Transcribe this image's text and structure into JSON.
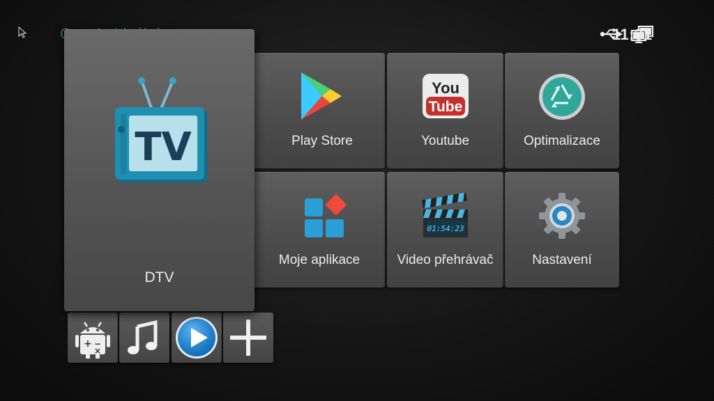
{
  "header": {
    "title": "Google Ideální",
    "clock": "11:31",
    "icons": [
      "usb-icon",
      "network-icon"
    ]
  },
  "tiles": {
    "dtv": {
      "label": "DTV",
      "icon": "tv-icon"
    },
    "play_store": {
      "label": "Play Store",
      "icon": "play-store-icon"
    },
    "youtube": {
      "label": "Youtube",
      "icon": "youtube-icon",
      "logo_top": "You",
      "logo_bottom": "Tube"
    },
    "optimalizace": {
      "label": "Optimalizace",
      "icon": "recycle-icon"
    },
    "moje_aplikace": {
      "label": "Moje aplikace",
      "icon": "apps-grid-icon"
    },
    "video": {
      "label": "Video přehrávač",
      "icon": "clapperboard-icon",
      "clap_text": "01:54:23"
    },
    "nastaveni": {
      "label": "Nastavení",
      "icon": "gear-icon"
    }
  },
  "shortcuts": [
    {
      "name": "android-calc-icon"
    },
    {
      "name": "music-note-icon"
    },
    {
      "name": "video-player-icon"
    },
    {
      "name": "add-icon"
    }
  ],
  "colors": {
    "teal_accent": "#2fa79a",
    "tv_blue": "#1e8fb0",
    "youtube_red": "#c4302b",
    "background": "#151515"
  }
}
